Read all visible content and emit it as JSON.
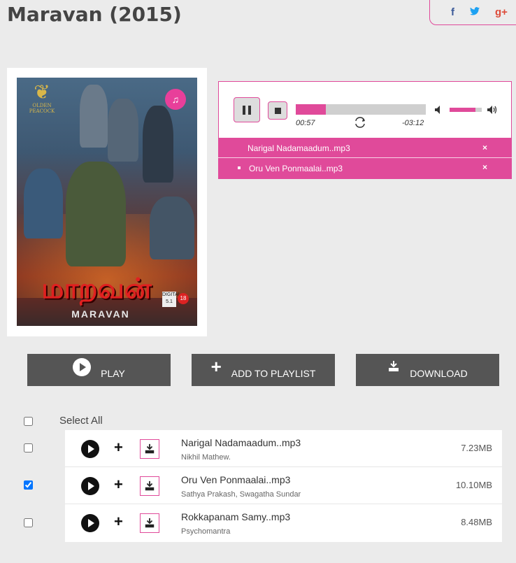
{
  "page": {
    "title": "Maravan (2015)"
  },
  "social": {
    "facebook": "f",
    "twitter": "t",
    "google_plus": "g+"
  },
  "poster": {
    "studio_name": "OLDEN PEACOCK",
    "title_art": "மாறவன்",
    "title_en": "MARAVAN",
    "audio_badge": "DIGITAL 5.1",
    "rating_badge": "18"
  },
  "player": {
    "current_time": "00:57",
    "remaining_time": "-03:12",
    "progress": 0.23,
    "volume": 0.8
  },
  "playlist": [
    {
      "name": "Narigal Nadamaadum..mp3",
      "remove": "×",
      "active": false
    },
    {
      "name": "Oru Ven Ponmaalai..mp3",
      "remove": "×",
      "active": true
    }
  ],
  "actions": {
    "play": "PLAY",
    "add_to_playlist": "ADD TO PLAYLIST",
    "download": "DOWNLOAD"
  },
  "select_all": {
    "label": "Select All",
    "checked": false
  },
  "songs": [
    {
      "title": "Narigal Nadamaadum..mp3",
      "artist": "Nikhil Mathew.",
      "size": "7.23MB",
      "checked": false
    },
    {
      "title": "Oru Ven Ponmaalai..mp3",
      "artist": "Sathya Prakash, Swagatha Sundar",
      "size": "10.10MB",
      "checked": true
    },
    {
      "title": "Rokkapanam Samy..mp3",
      "artist": "Psychomantra",
      "size": "8.48MB",
      "checked": false
    }
  ],
  "colors": {
    "accent": "#e04a9a",
    "button_bg": "#555555",
    "page_bg": "#ebebeb"
  }
}
